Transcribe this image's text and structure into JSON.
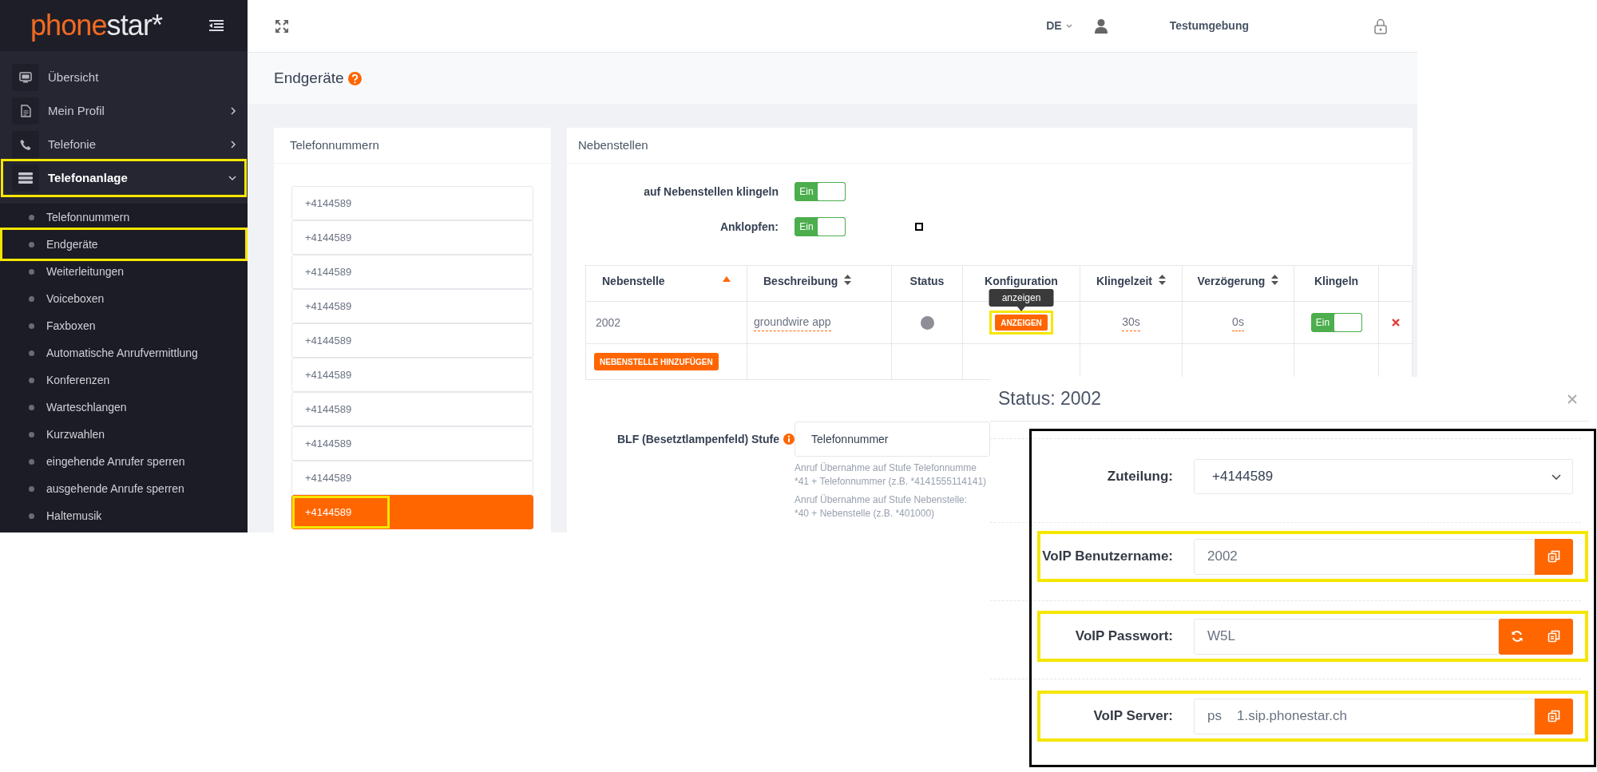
{
  "sidebar": {
    "logo": {
      "accent": "phone",
      "rest": "star*"
    },
    "menu": [
      {
        "label": "Übersicht",
        "selected": false,
        "highlighted": false
      },
      {
        "label": "Mein Profil",
        "expanded": false,
        "selected": false,
        "highlighted": false
      },
      {
        "label": "Telefonie",
        "expanded": false,
        "selected": false,
        "highlighted": false
      },
      {
        "label": "Telefonanlage",
        "expanded": true,
        "selected": true,
        "highlighted": true,
        "children": [
          {
            "label": "Telefonnummern",
            "highlighted": false
          },
          {
            "label": "Endgeräte",
            "highlighted": true
          },
          {
            "label": "Weiterleitungen",
            "highlighted": false
          },
          {
            "label": "Voiceboxen",
            "highlighted": false
          },
          {
            "label": "Faxboxen",
            "highlighted": false
          },
          {
            "label": "Automatische Anrufvermittlung",
            "highlighted": false
          },
          {
            "label": "Konferenzen",
            "highlighted": false
          },
          {
            "label": "Warteschlangen",
            "highlighted": false
          },
          {
            "label": "Kurzwahlen",
            "highlighted": false
          },
          {
            "label": "eingehende Anrufer sperren",
            "highlighted": false
          },
          {
            "label": "ausgehende Anrufe sperren",
            "highlighted": false
          },
          {
            "label": "Haltemusik",
            "highlighted": false
          }
        ]
      }
    ]
  },
  "topbar": {
    "language": "DE",
    "user": "Testumgebung"
  },
  "page_title": "Endgeräte",
  "phone_numbers": {
    "title": "Telefonnummern",
    "items": [
      {
        "number": "+4144589",
        "selected": false,
        "highlighted": false
      },
      {
        "number": "+4144589",
        "selected": false,
        "highlighted": false
      },
      {
        "number": "+4144589",
        "selected": false,
        "highlighted": false
      },
      {
        "number": "+4144589",
        "selected": false,
        "highlighted": false
      },
      {
        "number": "+4144589",
        "selected": false,
        "highlighted": false
      },
      {
        "number": "+4144589",
        "selected": false,
        "highlighted": false
      },
      {
        "number": "+4144589",
        "selected": false,
        "highlighted": false
      },
      {
        "number": "+4144589",
        "selected": false,
        "highlighted": false
      },
      {
        "number": "+4144589",
        "selected": false,
        "highlighted": false
      },
      {
        "number": "+4144589",
        "selected": true,
        "highlighted": true
      }
    ]
  },
  "extensions": {
    "title": "Nebenstellen",
    "toggles": [
      {
        "label": "auf Nebenstellen klingeln",
        "on": true,
        "state_label": "Ein"
      },
      {
        "label": "Anklopfen:",
        "on": true,
        "state_label": "Ein"
      }
    ],
    "table": {
      "columns": [
        {
          "label": "Nebenstelle",
          "sortable": true,
          "sorted": true
        },
        {
          "label": "Beschreibung",
          "sortable": true,
          "sorted": false
        },
        {
          "label": "Status",
          "sortable": false
        },
        {
          "label": "Konfiguration",
          "sortable": false
        },
        {
          "label": "Klingelzeit",
          "sortable": true,
          "sorted": false
        },
        {
          "label": "Verzögerung",
          "sortable": true,
          "sorted": false
        },
        {
          "label": "Klingeln",
          "sortable": false
        }
      ],
      "rows": [
        {
          "extension": "2002",
          "description": "groundwire app",
          "online": false,
          "config_button": "ANZEIGEN",
          "config_highlighted": true,
          "tooltip": "anzeigen",
          "ring_time": "30s",
          "delay": "0s",
          "ring": {
            "on": true,
            "state_label": "Ein"
          },
          "deletable": true
        }
      ]
    },
    "add_button": "NEBENSTELLE HINZUFÜGEN",
    "blf": {
      "label": "BLF (Besetztlampenfeld) Stufe",
      "value": "Telefonnummer",
      "help": [
        "Anruf Übernahme auf Stufe Telefonnumme",
        "*41 + Telefonnummer (z.B. *4141555114141)",
        "Anruf Übernahme auf Stufe Nebenstelle:",
        "*40 + Nebenstelle (z.B. *401000)"
      ]
    }
  },
  "status_panel": {
    "title": "Status: 2002",
    "rows": [
      {
        "kind": "select",
        "label": "Zuteilung:",
        "value_parts": [
          "+4144589"
        ],
        "highlighted": false
      },
      {
        "kind": "field",
        "label": "VoIP Benutzername:",
        "value_parts": [
          "2002"
        ],
        "can_regenerate": false,
        "highlighted": true
      },
      {
        "kind": "field",
        "label": "VoIP Passwort:",
        "value_parts": [
          "W5L"
        ],
        "can_regenerate": true,
        "highlighted": true
      },
      {
        "kind": "field",
        "label": "VoIP Server:",
        "value_parts": [
          "ps",
          "1.sip.phonestar.ch"
        ],
        "can_regenerate": false,
        "highlighted": true
      }
    ]
  }
}
